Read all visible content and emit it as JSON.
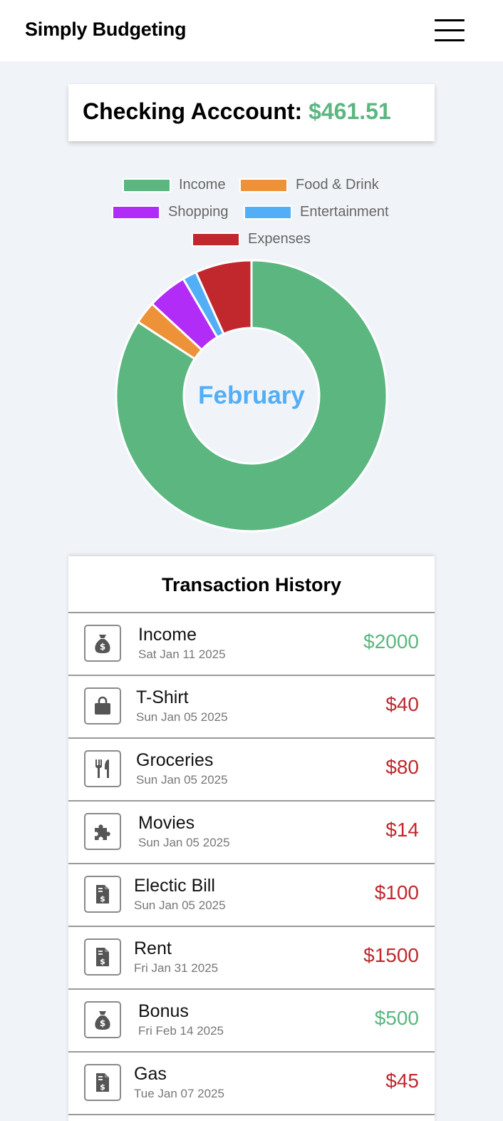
{
  "app": {
    "title": "Simply Budgeting"
  },
  "balance": {
    "label": "Checking Acccount:",
    "value": "$461.51"
  },
  "colors": {
    "income": "#5bb680",
    "food": "#ee923a",
    "shopping": "#b22cf7",
    "entertainment": "#52aef6",
    "expenses": "#c0282d"
  },
  "chart_data": {
    "type": "pie",
    "variant": "doughnut",
    "center_label": "February",
    "legend_position": "top",
    "categories": [
      "Income",
      "Food & Drink",
      "Shopping",
      "Entertainment",
      "Expenses"
    ],
    "values": [
      2500,
      80,
      140,
      50,
      200
    ],
    "colors": [
      "#5bb680",
      "#ee923a",
      "#b22cf7",
      "#52aef6",
      "#c0282d"
    ]
  },
  "transactions": {
    "title": "Transaction History",
    "items": [
      {
        "name": "Income",
        "date": "Sat Jan 11 2025",
        "amount": "$2000",
        "type": "pos",
        "icon": "money-bag-icon"
      },
      {
        "name": "T-Shirt",
        "date": "Sun Jan 05 2025",
        "amount": "$40",
        "type": "neg",
        "icon": "shopping-bag-icon"
      },
      {
        "name": "Groceries",
        "date": "Sun Jan 05 2025",
        "amount": "$80",
        "type": "neg",
        "icon": "utensils-icon"
      },
      {
        "name": "Movies",
        "date": "Sun Jan 05 2025",
        "amount": "$14",
        "type": "neg",
        "icon": "puzzle-icon"
      },
      {
        "name": "Electic Bill",
        "date": "Sun Jan 05 2025",
        "amount": "$100",
        "type": "neg",
        "icon": "invoice-icon"
      },
      {
        "name": "Rent",
        "date": "Fri Jan 31 2025",
        "amount": "$1500",
        "type": "neg",
        "icon": "invoice-icon"
      },
      {
        "name": "Bonus",
        "date": "Fri Feb 14 2025",
        "amount": "$500",
        "type": "pos",
        "icon": "money-bag-icon"
      },
      {
        "name": "Gas",
        "date": "Tue Jan 07 2025",
        "amount": "$45",
        "type": "neg",
        "icon": "invoice-icon"
      }
    ]
  }
}
